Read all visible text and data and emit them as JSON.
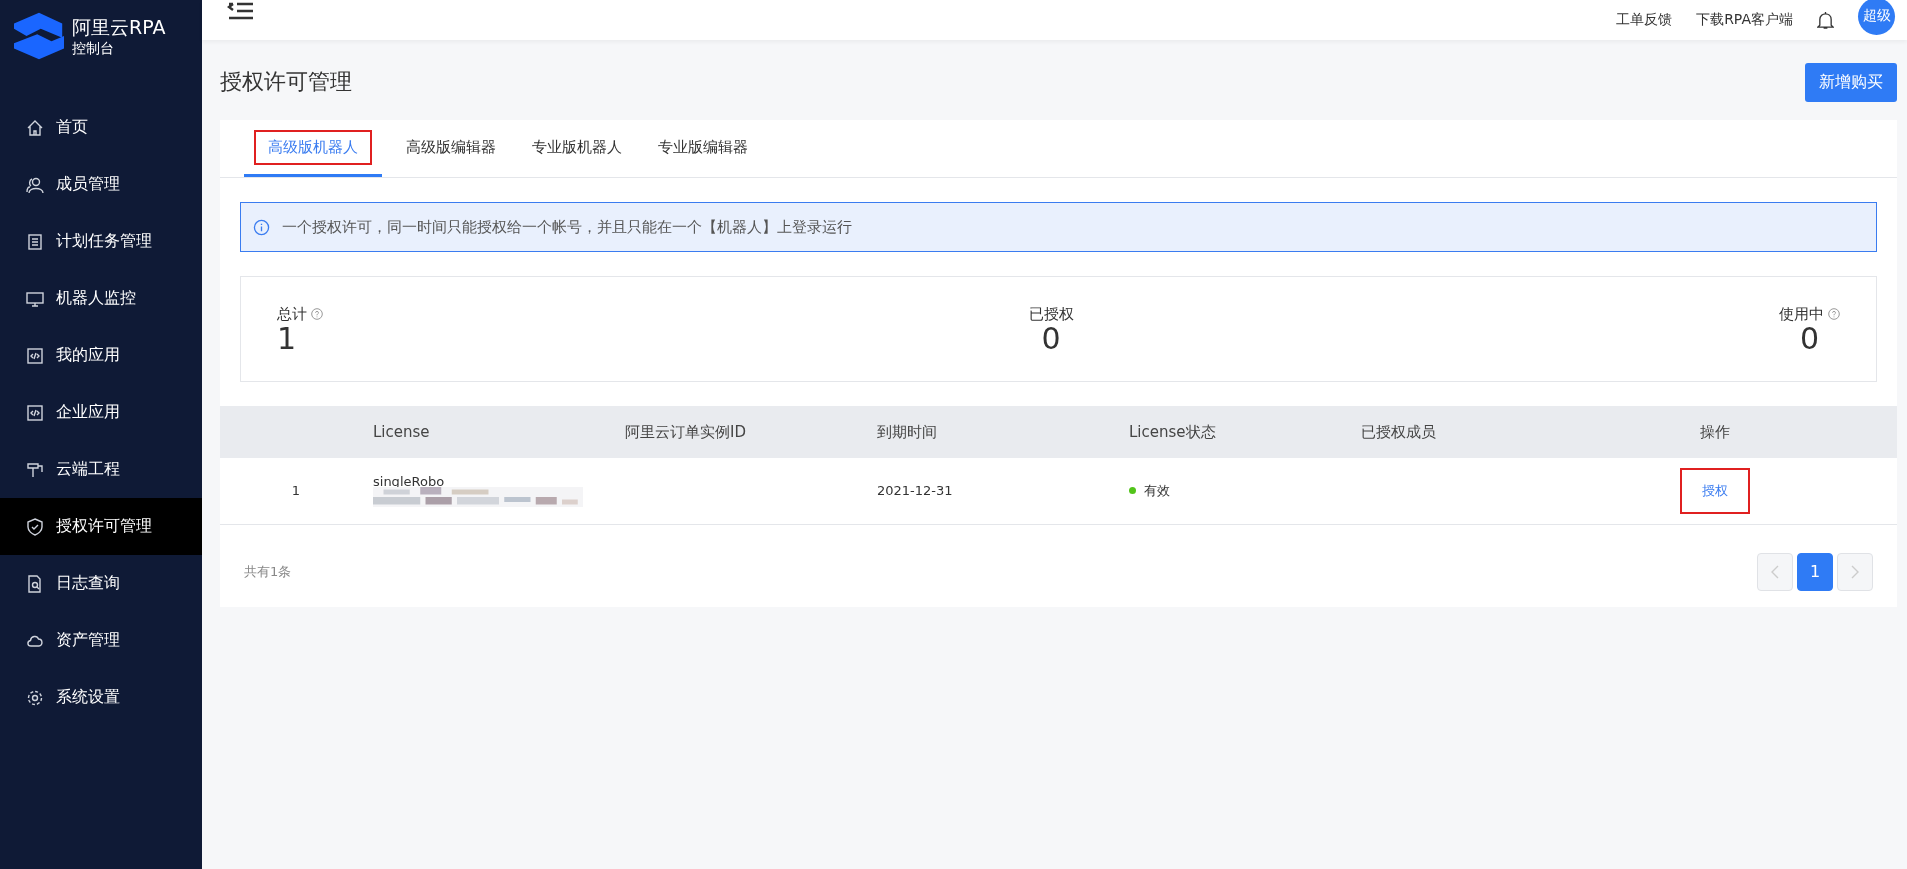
{
  "brand": {
    "title": "阿里云RPA",
    "subtitle": "控制台"
  },
  "sidebar": {
    "items": [
      {
        "label": "首页",
        "selected": false
      },
      {
        "label": "成员管理",
        "selected": false
      },
      {
        "label": "计划任务管理",
        "selected": false
      },
      {
        "label": "机器人监控",
        "selected": false
      },
      {
        "label": "我的应用",
        "selected": false
      },
      {
        "label": "企业应用",
        "selected": false
      },
      {
        "label": "云端工程",
        "selected": false
      },
      {
        "label": "授权许可管理",
        "selected": true
      },
      {
        "label": "日志查询",
        "selected": false
      },
      {
        "label": "资产管理",
        "selected": false
      },
      {
        "label": "系统设置",
        "selected": false
      }
    ]
  },
  "header": {
    "links": [
      "工单反馈",
      "下载RPA客户端"
    ],
    "avatar": "超级"
  },
  "page": {
    "title": "授权许可管理",
    "action": "新增购买"
  },
  "tabs": [
    {
      "label": "高级版机器人",
      "selected": true,
      "highlighted": true
    },
    {
      "label": "高级版编辑器",
      "selected": false,
      "highlighted": false
    },
    {
      "label": "专业版机器人",
      "selected": false,
      "highlighted": false
    },
    {
      "label": "专业版编辑器",
      "selected": false,
      "highlighted": false
    }
  ],
  "alert": "一个授权许可，同一时间只能授权给一个帐号，并且只能在一个【机器人】上登录运行",
  "stats": [
    {
      "label": "总计",
      "value": "1",
      "help": true
    },
    {
      "label": "已授权",
      "value": "0",
      "help": false
    },
    {
      "label": "使用中",
      "value": "0",
      "help": true
    }
  ],
  "table": {
    "columns": [
      "",
      "License",
      "阿里云订单实例ID",
      "到期时间",
      "License状态",
      "已授权成员",
      "操作"
    ],
    "rows": [
      {
        "index": "1",
        "license": "singleRobo",
        "expiry": "2021-12-31",
        "status": {
          "label": "有效",
          "color": "#52c41a"
        },
        "action": "授权",
        "action_highlighted": true
      }
    ]
  },
  "footer": {
    "total": "共有1条",
    "pages": [
      {
        "label": "1",
        "selected": true
      }
    ]
  }
}
